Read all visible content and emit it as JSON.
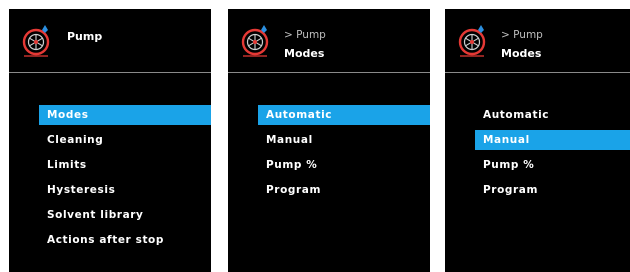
{
  "colors": {
    "background": "#000000",
    "highlight": "#1aa3e8",
    "text": "#ffffff",
    "pump_icon": "#e53935"
  },
  "screens": [
    {
      "title": "Pump",
      "icon": "pump-icon",
      "items": [
        "Modes",
        "Cleaning",
        "Limits",
        "Hysteresis",
        "Solvent library",
        "Actions after stop"
      ],
      "selected_index": 0
    },
    {
      "breadcrumb": "> Pump",
      "title": "Modes",
      "icon": "pump-icon",
      "items": [
        "Automatic",
        "Manual",
        "Pump %",
        "Program"
      ],
      "selected_index": 0
    },
    {
      "breadcrumb": "> Pump",
      "title": "Modes",
      "icon": "pump-icon",
      "items": [
        "Automatic",
        "Manual",
        "Pump %",
        "Program"
      ],
      "selected_index": 1
    }
  ]
}
